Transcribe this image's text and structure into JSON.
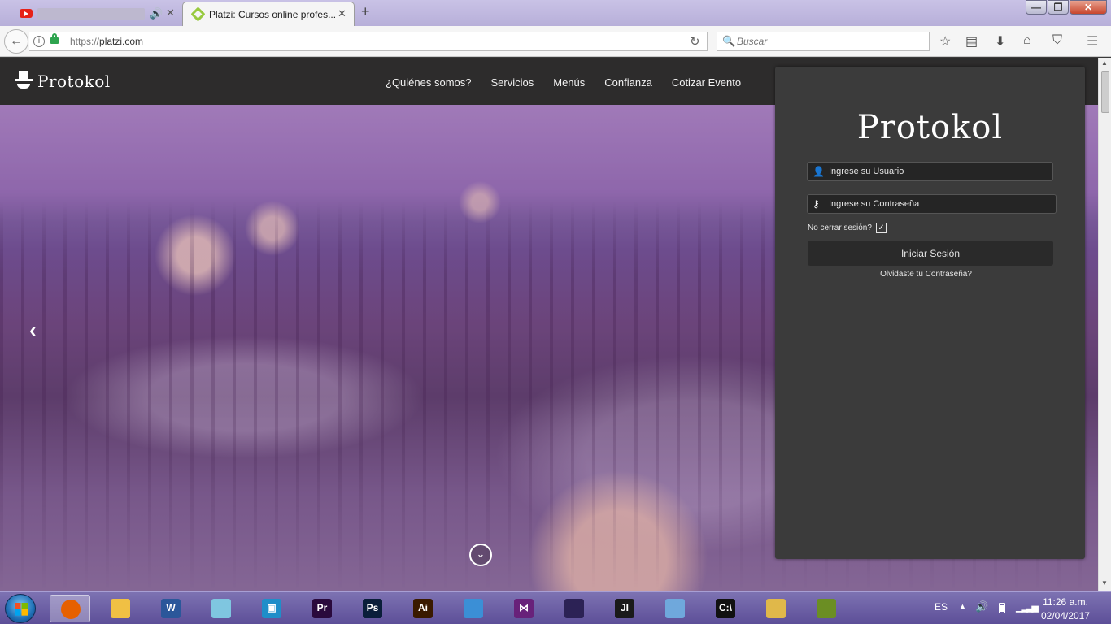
{
  "browser": {
    "tabs": [
      {
        "label": "",
        "icon": "youtube-icon",
        "audio_icon": "speaker-icon"
      },
      {
        "label": "Platzi: Cursos online profes...",
        "icon": "platzi-icon"
      }
    ],
    "tab_close_glyph": "✕",
    "new_tab_glyph": "+",
    "window_controls": {
      "minimize": "—",
      "maximize": "❐",
      "close": "✕"
    },
    "url_protocol": "https://",
    "url_host": "platzi.com",
    "search_placeholder": "Buscar",
    "toolbar_icons": [
      "bookmark-star-icon",
      "reading-list-icon",
      "download-icon",
      "home-icon",
      "pocket-icon",
      "menu-icon"
    ]
  },
  "site": {
    "logo_text": "Protokol",
    "nav": [
      "¿Quiénes somos?",
      "Servicios",
      "Menús",
      "Confianza",
      "Cotizar Evento"
    ]
  },
  "login": {
    "logo_text": "Protokol",
    "user_placeholder": "Ingrese su Usuario",
    "password_placeholder": "Ingrese su Contraseña",
    "remember_label": "No cerrar sesión?",
    "remember_checked": true,
    "submit_label": "Iniciar Sesión",
    "forgot_label": "Olvidaste tu Contraseña?"
  },
  "taskbar": {
    "apps": [
      {
        "name": "firefox",
        "label": "",
        "color": "#e66000",
        "active": true
      },
      {
        "name": "file-explorer",
        "label": "",
        "color": "#f0c044"
      },
      {
        "name": "word",
        "label": "W",
        "color": "#2b579a"
      },
      {
        "name": "notepad",
        "label": "",
        "color": "#7fc6e0"
      },
      {
        "name": "app-blue",
        "label": "▣",
        "color": "#1f8ec9"
      },
      {
        "name": "premiere",
        "label": "Pr",
        "color": "#2a0a3d"
      },
      {
        "name": "photoshop",
        "label": "Ps",
        "color": "#0a1e3a"
      },
      {
        "name": "illustrator",
        "label": "Ai",
        "color": "#3a1a00"
      },
      {
        "name": "visual-studio-files",
        "label": "",
        "color": "#3b8fd6"
      },
      {
        "name": "visual-studio",
        "label": "⋈",
        "color": "#68217a"
      },
      {
        "name": "eclipse",
        "label": "",
        "color": "#2c2255"
      },
      {
        "name": "intellij",
        "label": "JI",
        "color": "#1a1a1a"
      },
      {
        "name": "virtualbox",
        "label": "",
        "color": "#6fa8dc"
      },
      {
        "name": "cmd",
        "label": "C:\\",
        "color": "#111111"
      },
      {
        "name": "tools",
        "label": "",
        "color": "#e0b84a"
      },
      {
        "name": "network-app",
        "label": "",
        "color": "#6b8e23"
      }
    ],
    "language": "ES",
    "time": "11:26 a.m.",
    "date": "02/04/2017"
  }
}
